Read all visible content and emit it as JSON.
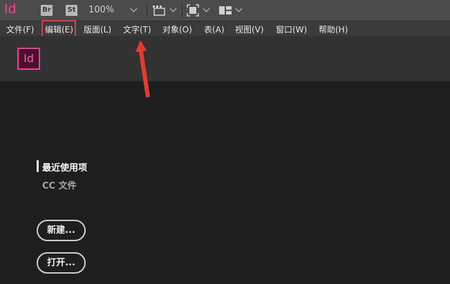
{
  "app": {
    "logo_text": "Id",
    "bridge_badge": "Br",
    "stock_badge": "St",
    "zoom": "100%"
  },
  "menu": [
    {
      "label": "文件(F)"
    },
    {
      "label": "编辑(E)"
    },
    {
      "label": "版面(L)"
    },
    {
      "label": "文字(T)"
    },
    {
      "label": "对象(O)"
    },
    {
      "label": "表(A)"
    },
    {
      "label": "视图(V)"
    },
    {
      "label": "窗口(W)"
    },
    {
      "label": "帮助(H)"
    }
  ],
  "home": {
    "logo_text": "Id",
    "nav": {
      "recent": "最近使用项",
      "cc_files": "CC 文件"
    },
    "buttons": {
      "new": "新建...",
      "open": "打开..."
    }
  },
  "colors": {
    "brand_pink": "#ff3d8e",
    "annotation_red": "#e23b3b",
    "background": "#1e1e1e"
  }
}
